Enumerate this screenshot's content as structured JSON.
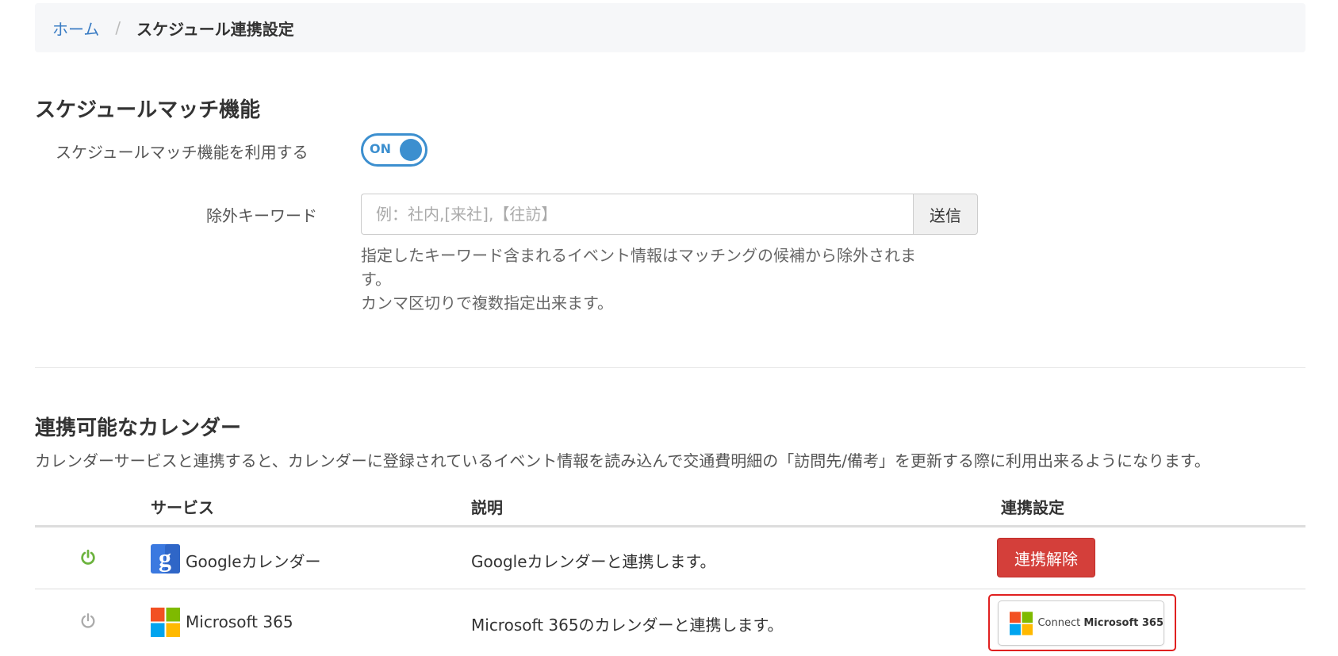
{
  "breadcrumb": {
    "home": "ホーム",
    "separator": "/",
    "current": "スケジュール連携設定"
  },
  "schedule_match": {
    "title": "スケジュールマッチ機能",
    "use_label": "スケジュールマッチ機能を利用する",
    "toggle_state": "ON",
    "keyword_label": "除外キーワード",
    "keyword_placeholder": "例：社内,[来社],【往訪】",
    "keyword_value": "",
    "send_button": "送信",
    "help_line1": "指定したキーワード含まれるイベント情報はマッチングの候補から除外されま",
    "help_line2": "す。",
    "help_line3": "カンマ区切りで複数指定出来ます。"
  },
  "calendars": {
    "title": "連携可能なカレンダー",
    "description": "カレンダーサービスと連携すると、カレンダーに登録されているイベント情報を読み込んで交通費明細の「訪問先/備考」を更新する際に利用出来るようになります。",
    "headers": {
      "service": "サービス",
      "description": "説明",
      "settings": "連携設定"
    },
    "rows": [
      {
        "service": "Googleカレンダー",
        "description": "Googleカレンダーと連携します。",
        "status": "connected",
        "status_color": "#6cb33e",
        "action": "連携解除",
        "icon": "google-icon"
      },
      {
        "service": "Microsoft 365",
        "description": "Microsoft 365のカレンダーと連携します。",
        "status": "disconnected",
        "status_color": "#aaaaaa",
        "action_prefix": "Connect",
        "action_brand": "Microsoft 365",
        "icon": "microsoft-icon"
      }
    ]
  }
}
